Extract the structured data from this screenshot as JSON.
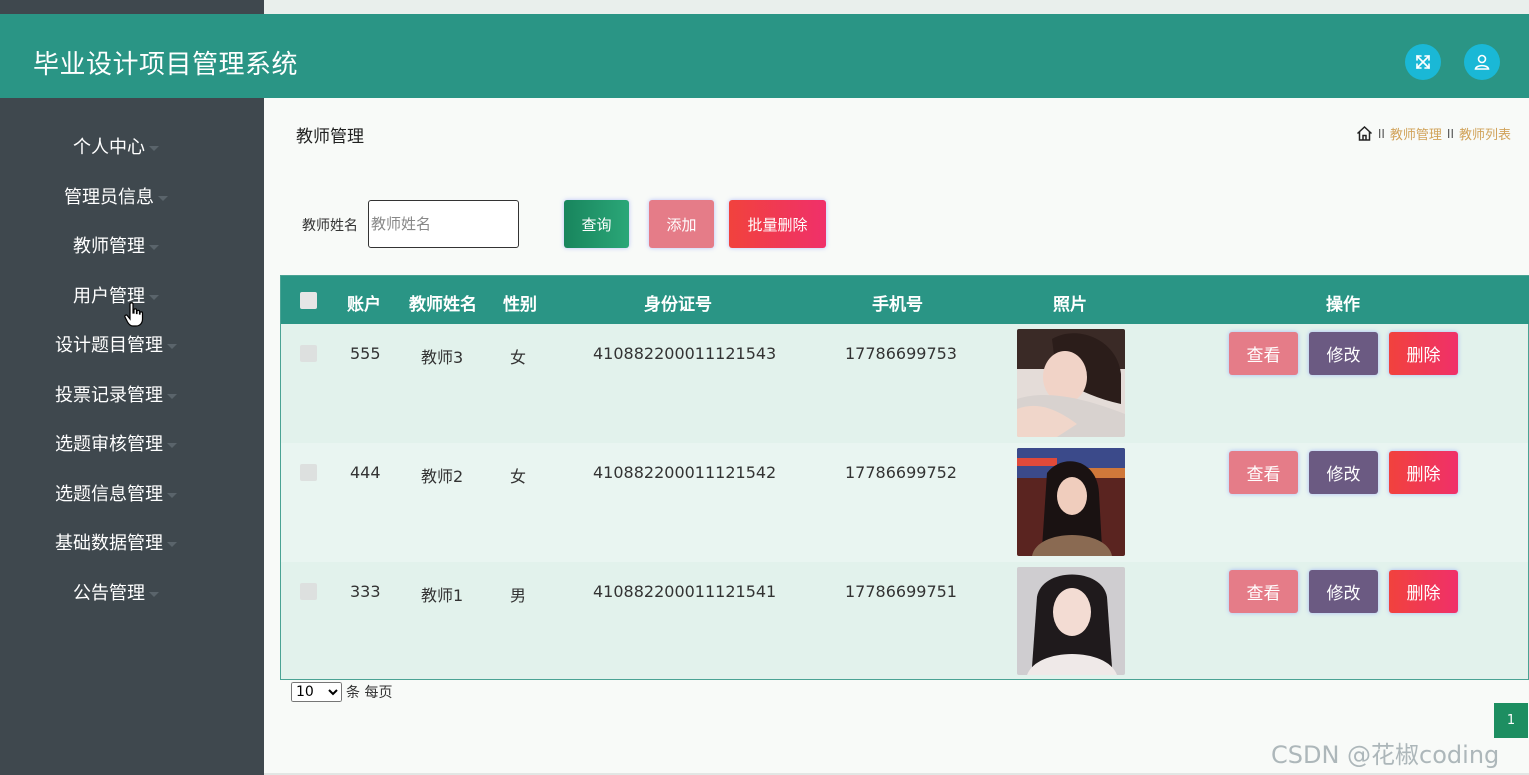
{
  "app": {
    "title": "毕业设计项目管理系统"
  },
  "header": {
    "icons": [
      "fullscreen-icon",
      "user-icon"
    ]
  },
  "sidebar": {
    "items": [
      {
        "label": "个人中心"
      },
      {
        "label": "管理员信息"
      },
      {
        "label": "教师管理"
      },
      {
        "label": "用户管理"
      },
      {
        "label": "设计题目管理"
      },
      {
        "label": "投票记录管理"
      },
      {
        "label": "选题审核管理"
      },
      {
        "label": "选题信息管理"
      },
      {
        "label": "基础数据管理"
      },
      {
        "label": "公告管理"
      }
    ]
  },
  "page": {
    "title": "教师管理",
    "breadcrumb": {
      "sep1": "II",
      "crumb1": "教师管理",
      "sep2": "II",
      "crumb2": "教师列表"
    }
  },
  "search": {
    "label": "教师姓名",
    "placeholder": "教师姓名",
    "query_label": "查询",
    "add_label": "添加",
    "batch_delete_label": "批量删除"
  },
  "table": {
    "headers": {
      "account": "账户",
      "name": "教师姓名",
      "gender": "性别",
      "id_number": "身份证号",
      "phone": "手机号",
      "photo": "照片",
      "actions": "操作"
    },
    "rows": [
      {
        "account": "555",
        "name": "教师3",
        "gender": "女",
        "id_number": "410882200011121543",
        "phone": "17786699753"
      },
      {
        "account": "444",
        "name": "教师2",
        "gender": "女",
        "id_number": "410882200011121542",
        "phone": "17786699752"
      },
      {
        "account": "333",
        "name": "教师1",
        "gender": "男",
        "id_number": "410882200011121541",
        "phone": "17786699751"
      }
    ],
    "actions": {
      "view": "查看",
      "edit": "修改",
      "delete": "删除"
    }
  },
  "pagination": {
    "page_size": "10",
    "page_size_suffix": "条 每页",
    "current_page": "1"
  },
  "watermark": "CSDN @花椒coding",
  "colors": {
    "header": "#2a9585",
    "sidebar": "#3f484e",
    "pink": "#e57c88",
    "purple": "#6b5a82",
    "red": "#f1423d",
    "green": "#1d8e61"
  }
}
